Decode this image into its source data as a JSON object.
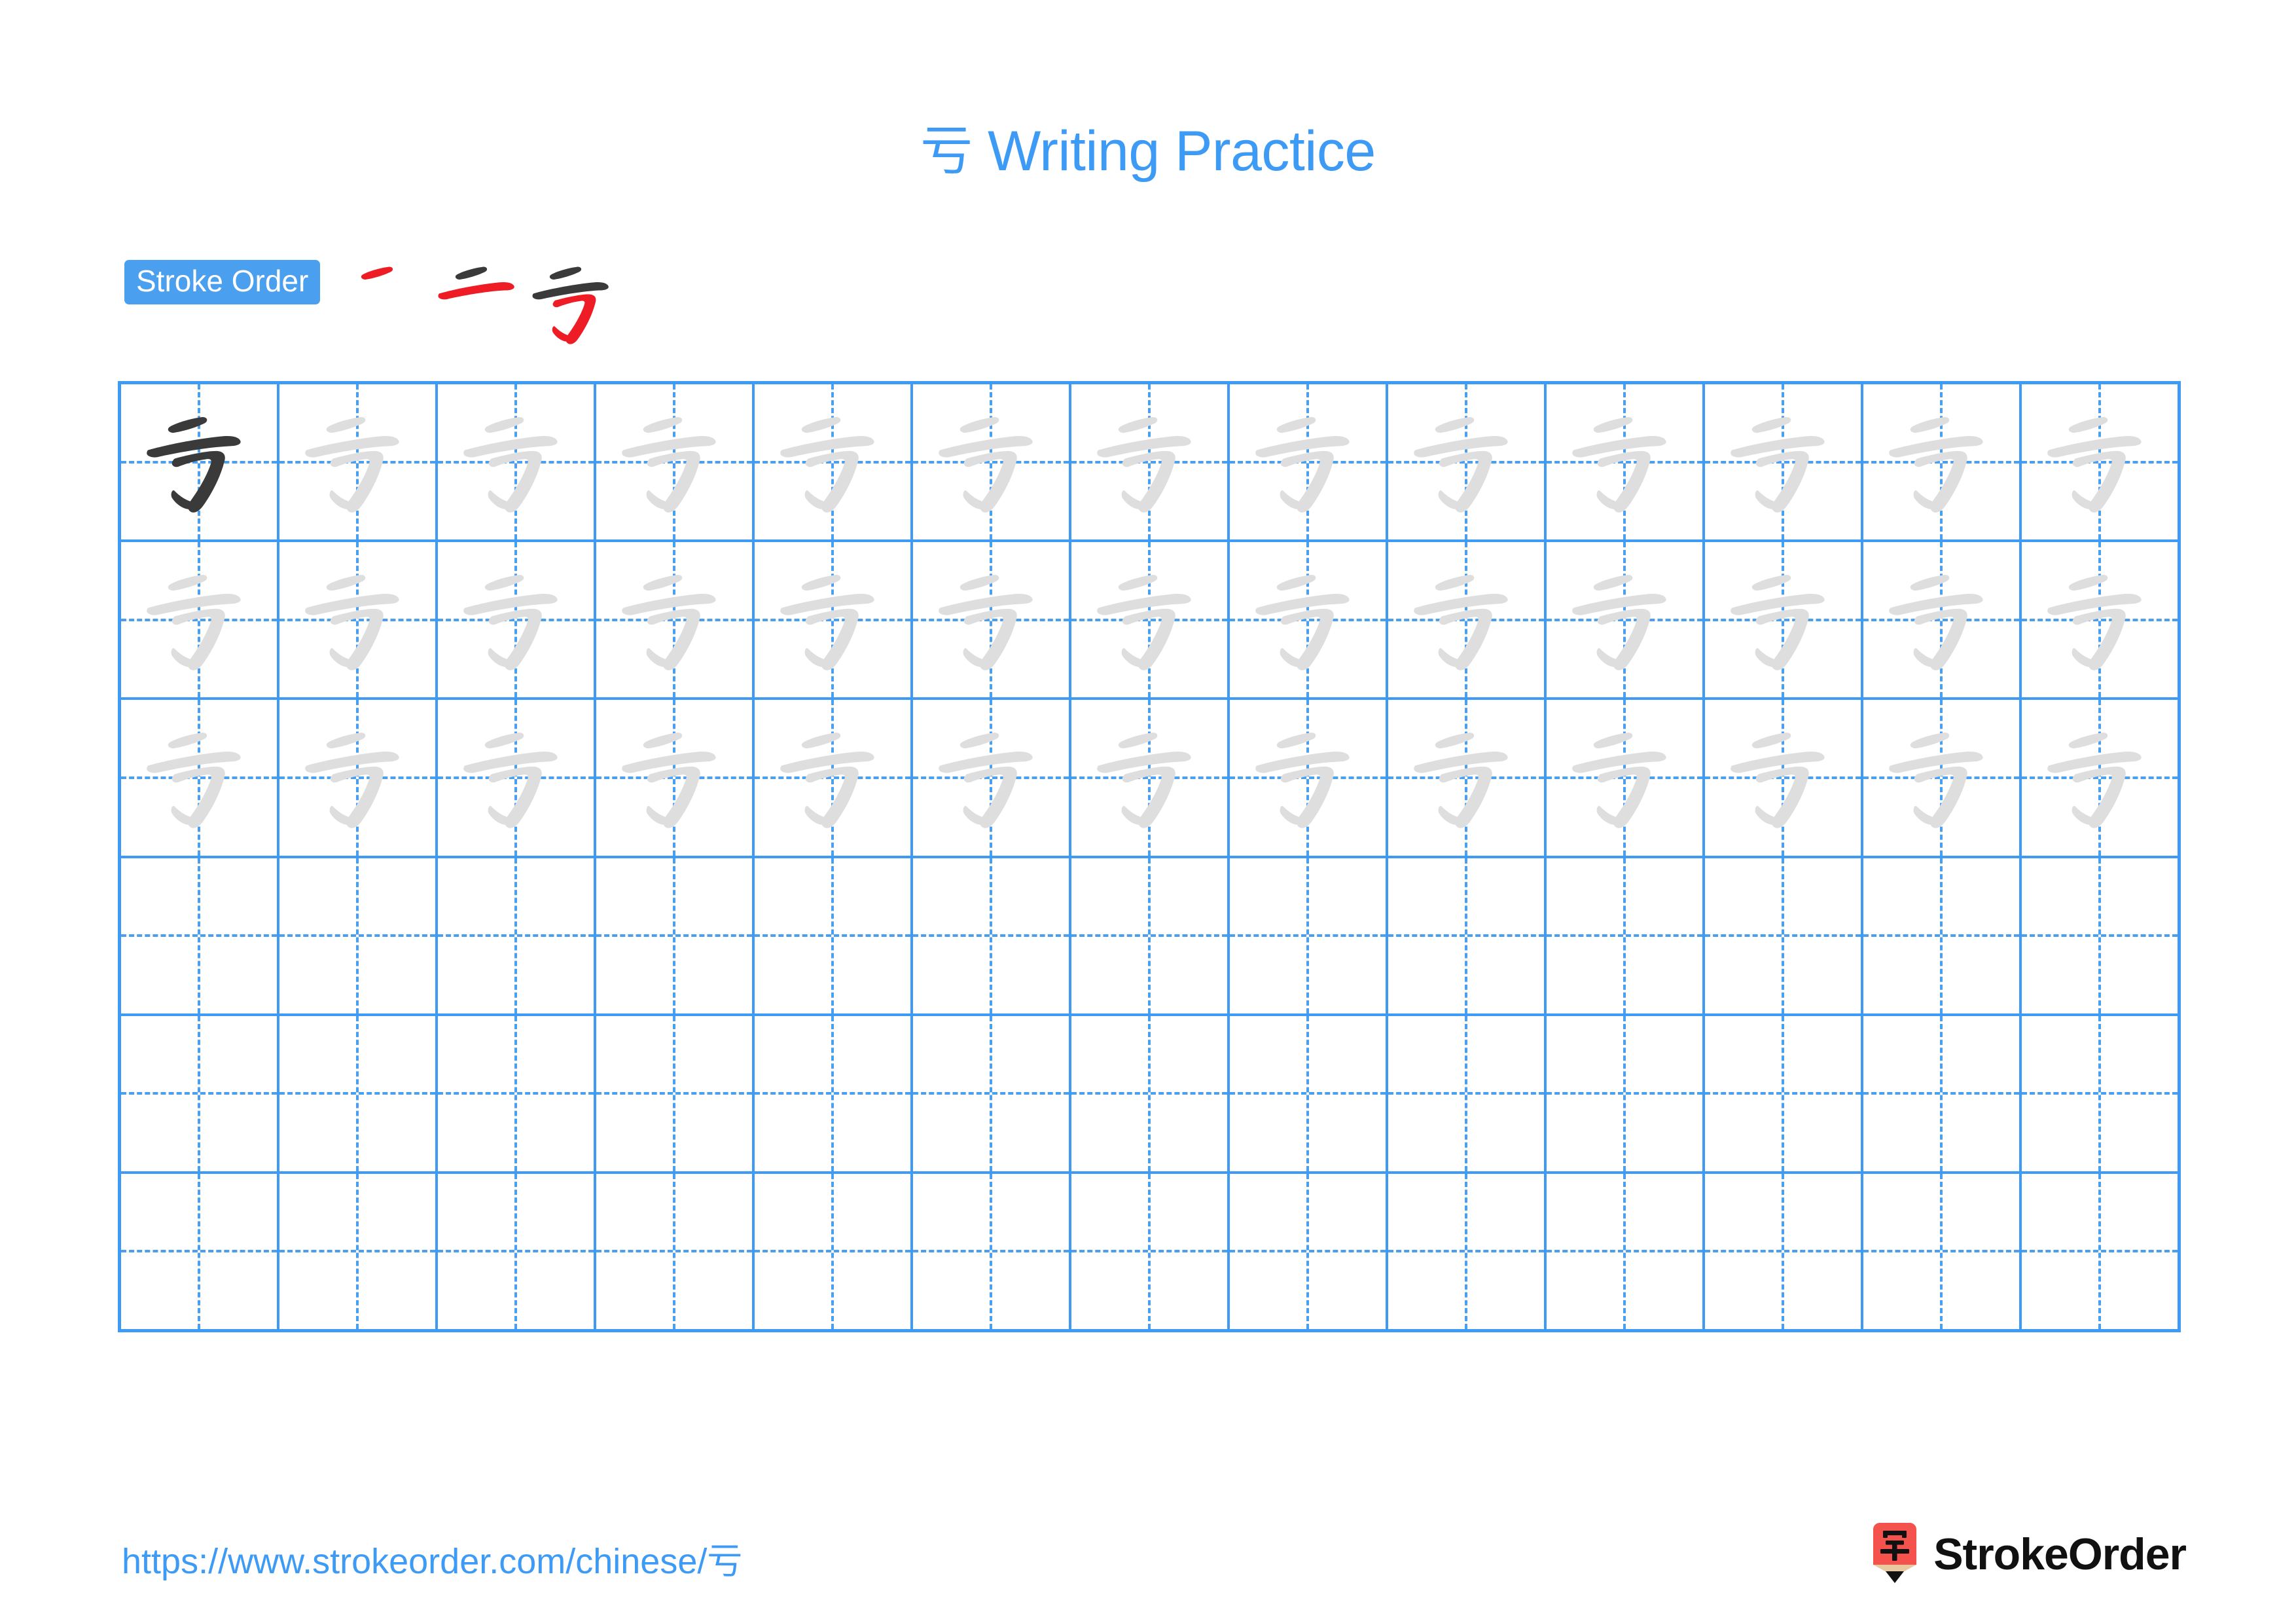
{
  "character": "亏",
  "header": {
    "title_char": "亏",
    "title_text": " Writing Practice",
    "title_color": "#3d9bf5"
  },
  "stroke_order": {
    "badge_label": "Stroke Order",
    "badge_bg": "#4a9fee",
    "badge_text_color": "#ffffff",
    "stroke_count": 3,
    "new_stroke_color": "#ee1c25",
    "old_stroke_color": "#3a3a3a",
    "steps": [
      {
        "index": 1,
        "name": "stroke-step-1",
        "strokes_shown": 1
      },
      {
        "index": 2,
        "name": "stroke-step-2",
        "strokes_shown": 2
      },
      {
        "index": 3,
        "name": "stroke-step-3",
        "strokes_shown": 3
      }
    ]
  },
  "grid": {
    "rows": 6,
    "columns": 13,
    "line_color": "#3d9bf5",
    "guide_color": "#4a9fee",
    "model_char_color": "#3a3a3a",
    "trace_char_color": "#dedede",
    "row_fill": [
      [
        "model",
        "trace",
        "trace",
        "trace",
        "trace",
        "trace",
        "trace",
        "trace",
        "trace",
        "trace",
        "trace",
        "trace",
        "trace"
      ],
      [
        "trace",
        "trace",
        "trace",
        "trace",
        "trace",
        "trace",
        "trace",
        "trace",
        "trace",
        "trace",
        "trace",
        "trace",
        "trace"
      ],
      [
        "trace",
        "trace",
        "trace",
        "trace",
        "trace",
        "trace",
        "trace",
        "trace",
        "trace",
        "trace",
        "trace",
        "trace",
        "trace"
      ],
      [
        "empty",
        "empty",
        "empty",
        "empty",
        "empty",
        "empty",
        "empty",
        "empty",
        "empty",
        "empty",
        "empty",
        "empty",
        "empty"
      ],
      [
        "empty",
        "empty",
        "empty",
        "empty",
        "empty",
        "empty",
        "empty",
        "empty",
        "empty",
        "empty",
        "empty",
        "empty",
        "empty"
      ],
      [
        "empty",
        "empty",
        "empty",
        "empty",
        "empty",
        "empty",
        "empty",
        "empty",
        "empty",
        "empty",
        "empty",
        "empty",
        "empty"
      ]
    ]
  },
  "footer": {
    "url_prefix": "https://www.strokeorder.com/chinese/",
    "url_char": "亏",
    "url_color": "#3d9bf5",
    "brand_name": "StrokeOrder",
    "logo_char": "字",
    "logo_bg": "#f4524c",
    "logo_tip": "#e8c9a0",
    "logo_point": "#111111"
  }
}
